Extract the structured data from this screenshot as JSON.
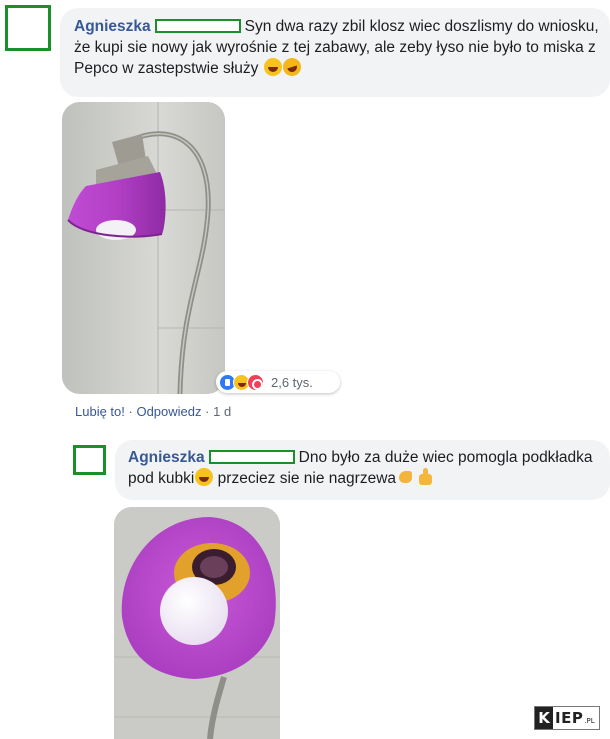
{
  "comment1": {
    "author": "Agnieszka",
    "text": "Syn dwa razy zbil klosz wiec doszlismy do wniosku, że kupi sie nowy jak wyrośnie z tej zabawy, ale zeby łyso nie było to miska z Pepco w zastepstwie służy",
    "emojis": [
      "laughing-tears-emoji",
      "rolling-laughing-emoji"
    ],
    "reactions": {
      "icons": [
        "like-reaction-icon",
        "haha-reaction-icon",
        "love-reaction-icon"
      ],
      "count": "2,6 tys."
    },
    "actions": {
      "like": "Lubię to!",
      "separator": "·",
      "reply": "Odpowiedz",
      "time": "1 d"
    }
  },
  "comment2": {
    "author": "Agnieszka",
    "text_part1": "Dno było za duże wiec pomogla podkładka pod kubki",
    "text_part2": " przeciez sie nie nagrzewa",
    "emojis": [
      "laughing-tears-emoji",
      "flexed-biceps-emoji",
      "thumbs-up-emoji"
    ]
  },
  "watermark": {
    "k": "K",
    "text": "IEP",
    "suffix": ".PL"
  },
  "colors": {
    "link": "#385898",
    "bubble": "#f2f3f5",
    "redaction_border": "#1a8f2a",
    "lamp_shade": "#b648c8"
  }
}
